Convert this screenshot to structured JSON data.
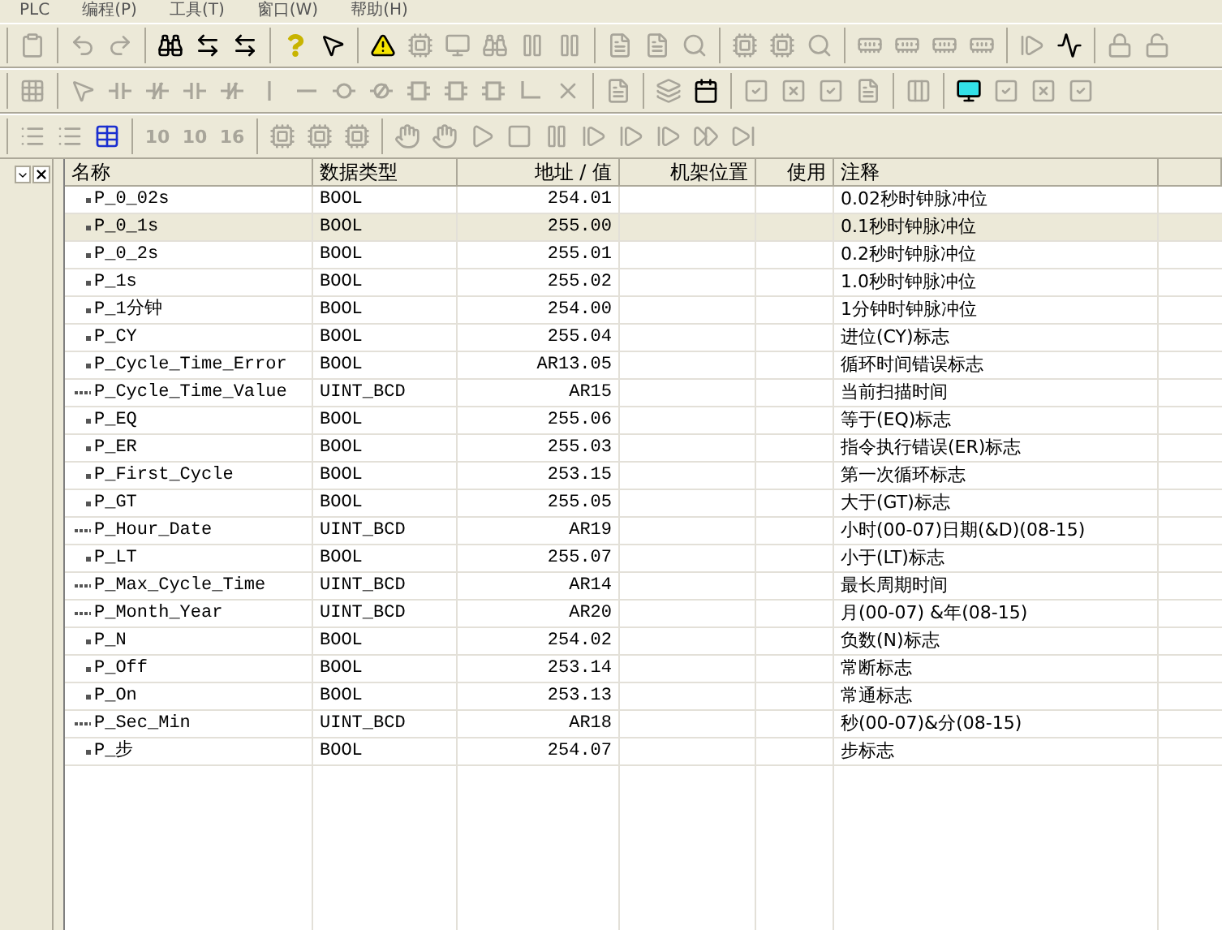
{
  "menu": [
    "PLC",
    "编程(P)",
    "工具(T)",
    "窗口(W)",
    "帮助(H)"
  ],
  "toolbars": [
    {
      "groups": [
        [
          {
            "kind": "paste",
            "disabled": true
          }
        ],
        [
          {
            "kind": "undo",
            "disabled": true
          },
          {
            "kind": "redo",
            "disabled": true
          }
        ],
        [
          {
            "kind": "find",
            "disabled": false
          },
          {
            "kind": "transfer",
            "disabled": false
          },
          {
            "kind": "transfer",
            "disabled": false
          }
        ],
        [
          {
            "kind": "help",
            "disabled": false
          },
          {
            "kind": "pointer-help",
            "disabled": false
          }
        ],
        [
          {
            "kind": "warning",
            "disabled": false
          },
          {
            "kind": "cpu",
            "disabled": true
          },
          {
            "kind": "monitor",
            "disabled": true
          },
          {
            "kind": "find",
            "disabled": true
          },
          {
            "kind": "pause",
            "disabled": true
          },
          {
            "kind": "pause",
            "disabled": true
          }
        ],
        [
          {
            "kind": "file",
            "disabled": true
          },
          {
            "kind": "file",
            "disabled": true
          },
          {
            "kind": "search",
            "disabled": true
          }
        ],
        [
          {
            "kind": "cpu",
            "disabled": true
          },
          {
            "kind": "cpu",
            "disabled": true
          },
          {
            "kind": "search",
            "disabled": true
          }
        ],
        [
          {
            "kind": "memory",
            "disabled": true
          },
          {
            "kind": "memory",
            "disabled": true
          },
          {
            "kind": "memory",
            "disabled": true
          },
          {
            "kind": "memory",
            "disabled": true
          }
        ],
        [
          {
            "kind": "step",
            "disabled": true
          },
          {
            "kind": "wave",
            "disabled": false
          }
        ],
        [
          {
            "kind": "lock",
            "disabled": true
          },
          {
            "kind": "unlock",
            "disabled": true
          }
        ]
      ]
    },
    {
      "groups": [
        [
          {
            "kind": "grid",
            "disabled": true
          }
        ],
        [
          {
            "kind": "pointer",
            "disabled": true
          },
          {
            "kind": "contact",
            "disabled": true
          },
          {
            "kind": "contact-closed",
            "disabled": true
          },
          {
            "kind": "contact",
            "disabled": true
          },
          {
            "kind": "contact-closed",
            "disabled": true
          },
          {
            "kind": "vertical-line",
            "disabled": true
          },
          {
            "kind": "horizontal-line",
            "disabled": true
          },
          {
            "kind": "coil",
            "disabled": true
          },
          {
            "kind": "coil-closed",
            "disabled": true
          },
          {
            "kind": "box",
            "disabled": true
          },
          {
            "kind": "box",
            "disabled": true
          },
          {
            "kind": "box",
            "disabled": true
          },
          {
            "kind": "corner",
            "disabled": true
          },
          {
            "kind": "delete",
            "disabled": true
          }
        ],
        [
          {
            "kind": "file",
            "disabled": true
          }
        ],
        [
          {
            "kind": "layers",
            "disabled": true
          },
          {
            "kind": "calendar",
            "disabled": false
          }
        ],
        [
          {
            "kind": "check-box",
            "disabled": true
          },
          {
            "kind": "cross-box",
            "disabled": true
          },
          {
            "kind": "check-box",
            "disabled": true
          },
          {
            "kind": "file",
            "disabled": true
          }
        ],
        [
          {
            "kind": "columns",
            "disabled": true
          }
        ],
        [
          {
            "kind": "monitor-cyan",
            "disabled": false
          },
          {
            "kind": "check-box",
            "disabled": true
          },
          {
            "kind": "cross-box",
            "disabled": true
          },
          {
            "kind": "check-box",
            "disabled": true
          }
        ]
      ]
    },
    {
      "groups": [
        [
          {
            "kind": "list",
            "disabled": true
          },
          {
            "kind": "list",
            "disabled": true
          },
          {
            "kind": "table",
            "disabled": false
          }
        ],
        [
          {
            "kind": "number",
            "label": "10",
            "disabled": true
          },
          {
            "kind": "number",
            "label": "10",
            "disabled": true
          },
          {
            "kind": "number",
            "label": "16",
            "disabled": true
          }
        ],
        [
          {
            "kind": "cpu",
            "disabled": true
          },
          {
            "kind": "cpu",
            "disabled": true
          },
          {
            "kind": "cpu",
            "disabled": true
          }
        ],
        [
          {
            "kind": "hand",
            "disabled": true
          },
          {
            "kind": "hand",
            "disabled": true
          },
          {
            "kind": "play",
            "disabled": true
          },
          {
            "kind": "stop",
            "disabled": true
          },
          {
            "kind": "pause",
            "disabled": true
          },
          {
            "kind": "step",
            "disabled": true
          },
          {
            "kind": "step",
            "disabled": true
          },
          {
            "kind": "step",
            "disabled": true
          },
          {
            "kind": "fast-forward",
            "disabled": true
          },
          {
            "kind": "skip-end",
            "disabled": true
          }
        ]
      ]
    }
  ],
  "table": {
    "columns": [
      {
        "label": "名称"
      },
      {
        "label": "数据类型"
      },
      {
        "label": "地址 / 值"
      },
      {
        "label": "机架位置"
      },
      {
        "label": "使用"
      },
      {
        "label": "注释"
      }
    ],
    "rows": [
      {
        "kind": "bit",
        "name": "P_0_02s",
        "type": "BOOL",
        "address": "254.01",
        "comment": "0.02秒时钟脉冲位",
        "selected": false
      },
      {
        "kind": "bit",
        "name": "P_0_1s",
        "type": "BOOL",
        "address": "255.00",
        "comment": "0.1秒时钟脉冲位",
        "selected": true
      },
      {
        "kind": "bit",
        "name": "P_0_2s",
        "type": "BOOL",
        "address": "255.01",
        "comment": "0.2秒时钟脉冲位",
        "selected": false
      },
      {
        "kind": "bit",
        "name": "P_1s",
        "type": "BOOL",
        "address": "255.02",
        "comment": "1.0秒时钟脉冲位",
        "selected": false
      },
      {
        "kind": "bit",
        "name": "P_1分钟",
        "type": "BOOL",
        "address": "254.00",
        "comment": "1分钟时钟脉冲位",
        "selected": false
      },
      {
        "kind": "bit",
        "name": "P_CY",
        "type": "BOOL",
        "address": "255.04",
        "comment": "进位(CY)标志",
        "selected": false
      },
      {
        "kind": "bit",
        "name": "P_Cycle_Time_Error",
        "type": "BOOL",
        "address": "AR13.05",
        "comment": "循环时间错误标志",
        "selected": false
      },
      {
        "kind": "word",
        "name": "P_Cycle_Time_Value",
        "type": "UINT_BCD",
        "address": "AR15",
        "comment": "当前扫描时间",
        "selected": false
      },
      {
        "kind": "bit",
        "name": "P_EQ",
        "type": "BOOL",
        "address": "255.06",
        "comment": "等于(EQ)标志",
        "selected": false
      },
      {
        "kind": "bit",
        "name": "P_ER",
        "type": "BOOL",
        "address": "255.03",
        "comment": "指令执行错误(ER)标志",
        "selected": false
      },
      {
        "kind": "bit",
        "name": "P_First_Cycle",
        "type": "BOOL",
        "address": "253.15",
        "comment": "第一次循环标志",
        "selected": false
      },
      {
        "kind": "bit",
        "name": "P_GT",
        "type": "BOOL",
        "address": "255.05",
        "comment": "大于(GT)标志",
        "selected": false
      },
      {
        "kind": "word",
        "name": "P_Hour_Date",
        "type": "UINT_BCD",
        "address": "AR19",
        "comment": "小时(00-07)日期(&D)(08-15)",
        "selected": false
      },
      {
        "kind": "bit",
        "name": "P_LT",
        "type": "BOOL",
        "address": "255.07",
        "comment": "小于(LT)标志",
        "selected": false
      },
      {
        "kind": "word",
        "name": "P_Max_Cycle_Time",
        "type": "UINT_BCD",
        "address": "AR14",
        "comment": "最长周期时间",
        "selected": false
      },
      {
        "kind": "word",
        "name": "P_Month_Year",
        "type": "UINT_BCD",
        "address": "AR20",
        "comment": "月(00-07) &年(08-15)",
        "selected": false
      },
      {
        "kind": "bit",
        "name": "P_N",
        "type": "BOOL",
        "address": "254.02",
        "comment": "负数(N)标志",
        "selected": false
      },
      {
        "kind": "bit",
        "name": "P_Off",
        "type": "BOOL",
        "address": "253.14",
        "comment": "常断标志",
        "selected": false
      },
      {
        "kind": "bit",
        "name": "P_On",
        "type": "BOOL",
        "address": "253.13",
        "comment": "常通标志",
        "selected": false
      },
      {
        "kind": "word",
        "name": "P_Sec_Min",
        "type": "UINT_BCD",
        "address": "AR18",
        "comment": "秒(00-07)&分(08-15)",
        "selected": false
      },
      {
        "kind": "bit",
        "name": "P_步",
        "type": "BOOL",
        "address": "254.07",
        "comment": "步标志",
        "selected": false
      }
    ]
  }
}
